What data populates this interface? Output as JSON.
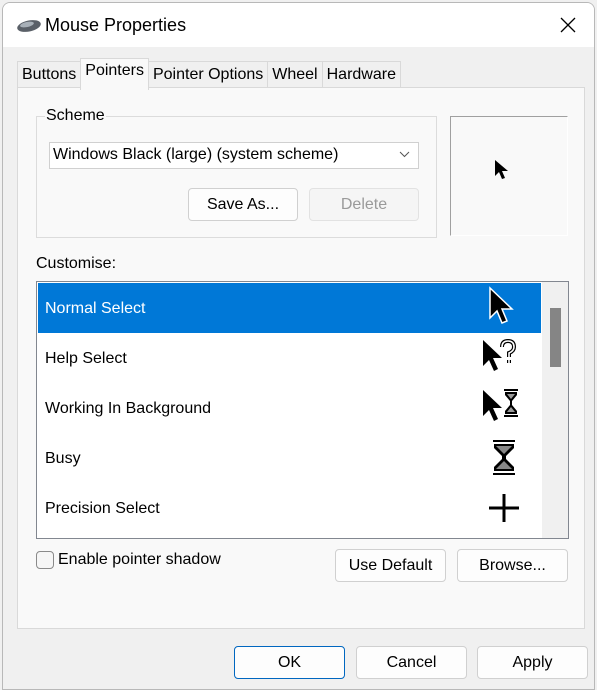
{
  "window": {
    "title": "Mouse Properties",
    "icon": "mouse-icon",
    "close_icon": "close-icon"
  },
  "tabs": [
    {
      "label": "Buttons",
      "active": false
    },
    {
      "label": "Pointers",
      "active": true
    },
    {
      "label": "Pointer Options",
      "active": false
    },
    {
      "label": "Wheel",
      "active": false
    },
    {
      "label": "Hardware",
      "active": false
    }
  ],
  "scheme": {
    "group_label": "Scheme",
    "selected": "Windows Black (large) (system scheme)",
    "save_as_label": "Save As...",
    "delete_label": "Delete",
    "delete_enabled": false
  },
  "customise": {
    "label": "Customise:",
    "items": [
      {
        "label": "Normal Select",
        "icon": "arrow-cursor-icon",
        "selected": true
      },
      {
        "label": "Help Select",
        "icon": "help-cursor-icon",
        "selected": false
      },
      {
        "label": "Working In Background",
        "icon": "working-cursor-icon",
        "selected": false
      },
      {
        "label": "Busy",
        "icon": "hourglass-icon",
        "selected": false
      },
      {
        "label": "Precision Select",
        "icon": "crosshair-icon",
        "selected": false
      }
    ]
  },
  "shadow": {
    "label": "Enable pointer shadow",
    "checked": false
  },
  "buttons": {
    "use_default": "Use Default",
    "browse": "Browse...",
    "ok": "OK",
    "cancel": "Cancel",
    "apply": "Apply"
  },
  "colors": {
    "selection": "#0078d7",
    "primary_border": "#0067c0"
  }
}
